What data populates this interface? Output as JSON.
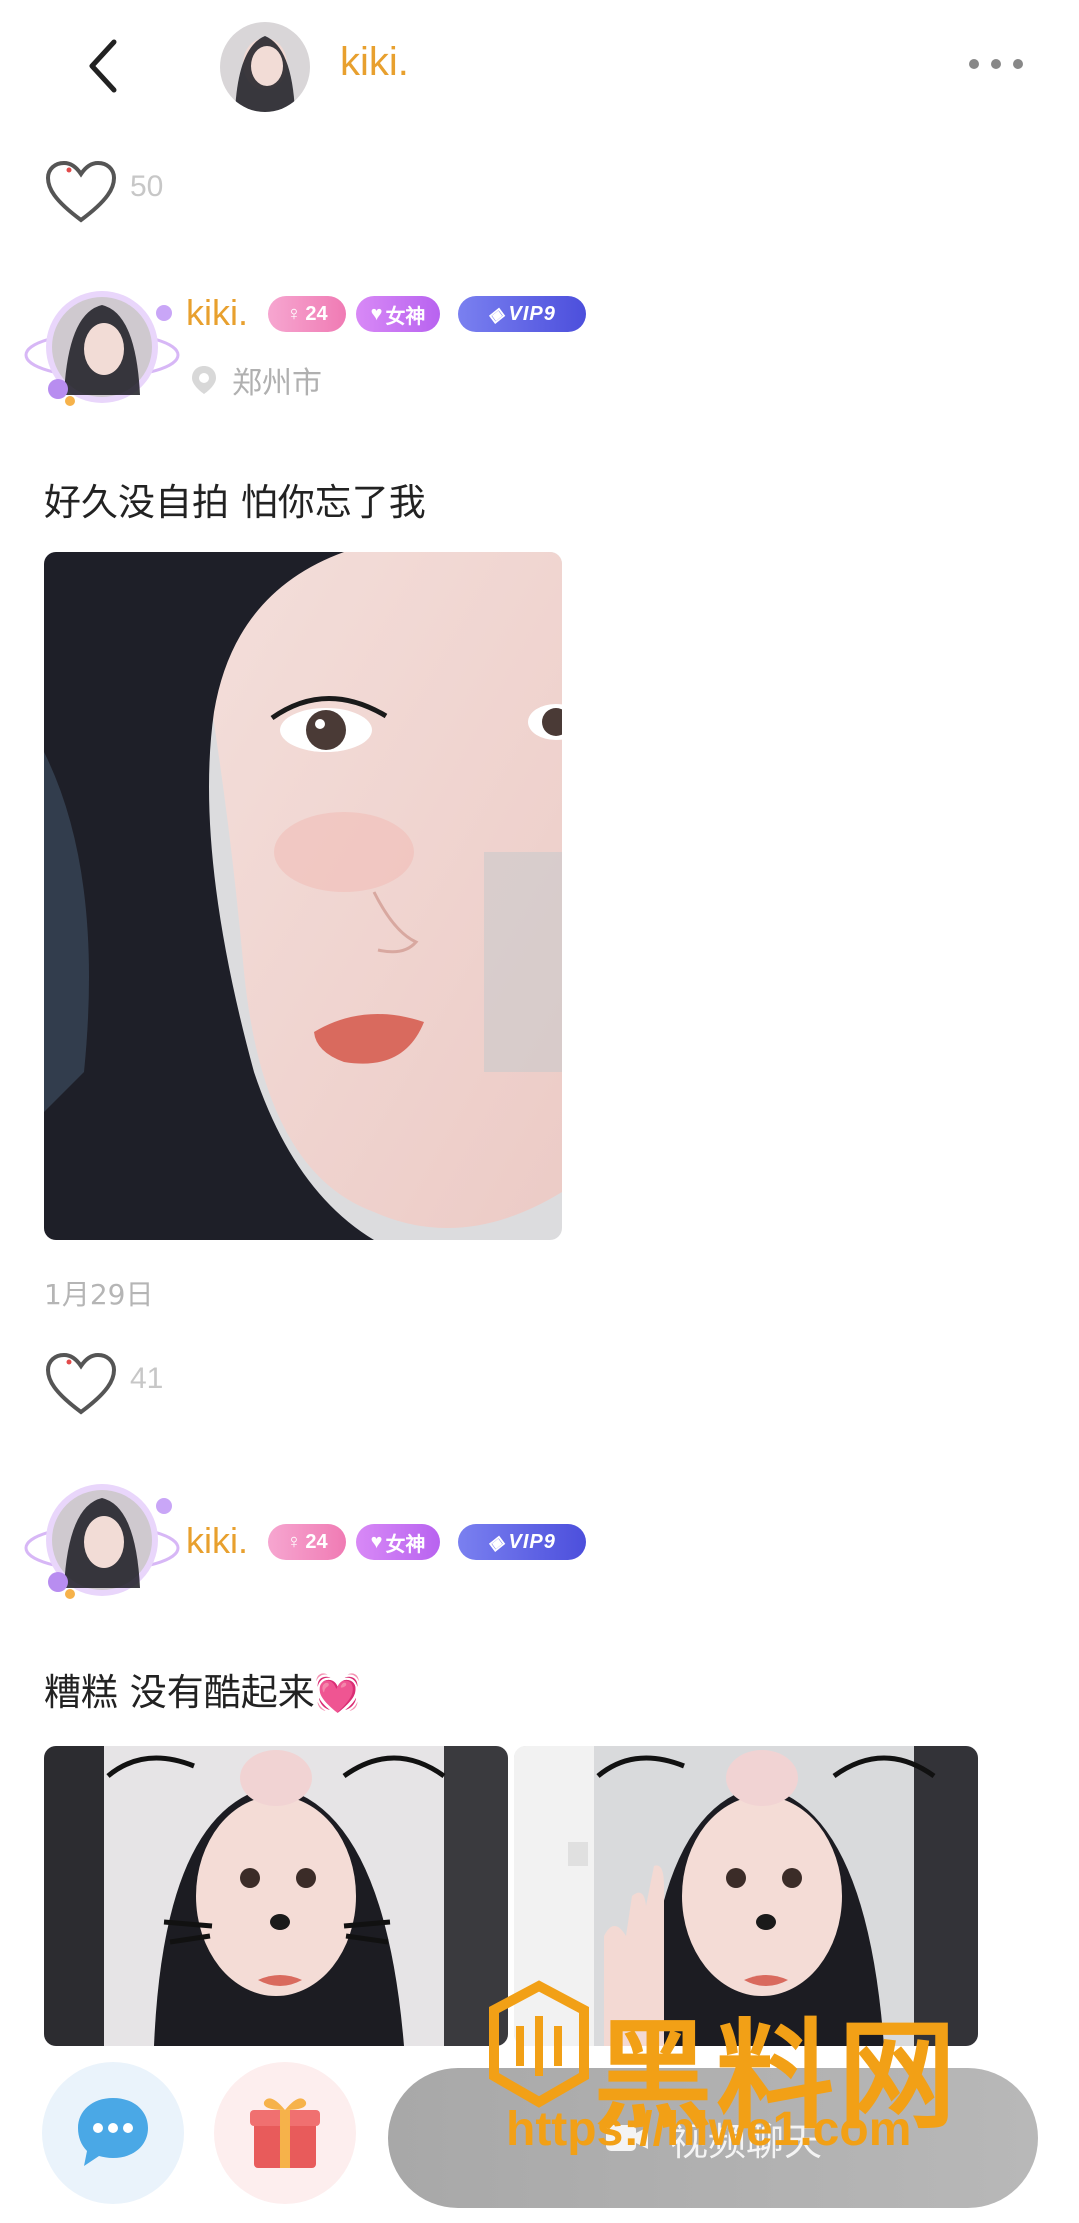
{
  "header": {
    "title": "kiki.",
    "back_icon": "chevron-left-icon",
    "more_icon": "more-dots-icon"
  },
  "posts": [
    {
      "like_count": "50"
    },
    {
      "author": "kiki.",
      "badges": {
        "age": "24",
        "goddess": "女神",
        "vip": "VIP9"
      },
      "location": "郑州市",
      "text": "好久没自拍 怕你忘了我",
      "date": "1月29日",
      "like_count": "41"
    },
    {
      "author": "kiki.",
      "badges": {
        "age": "24",
        "goddess": "女神",
        "vip": "VIP9"
      },
      "text": "糟糕 没有酷起来💓"
    }
  ],
  "bottom_bar": {
    "chat_icon": "chat-bubble-icon",
    "gift_icon": "gift-icon",
    "video_chat_label": "视频聊天"
  },
  "watermark": {
    "title": "黑料网",
    "url": "https://hlwe1.com"
  },
  "colors": {
    "accent": "#e8a02e",
    "watermark": "#f2a016"
  }
}
